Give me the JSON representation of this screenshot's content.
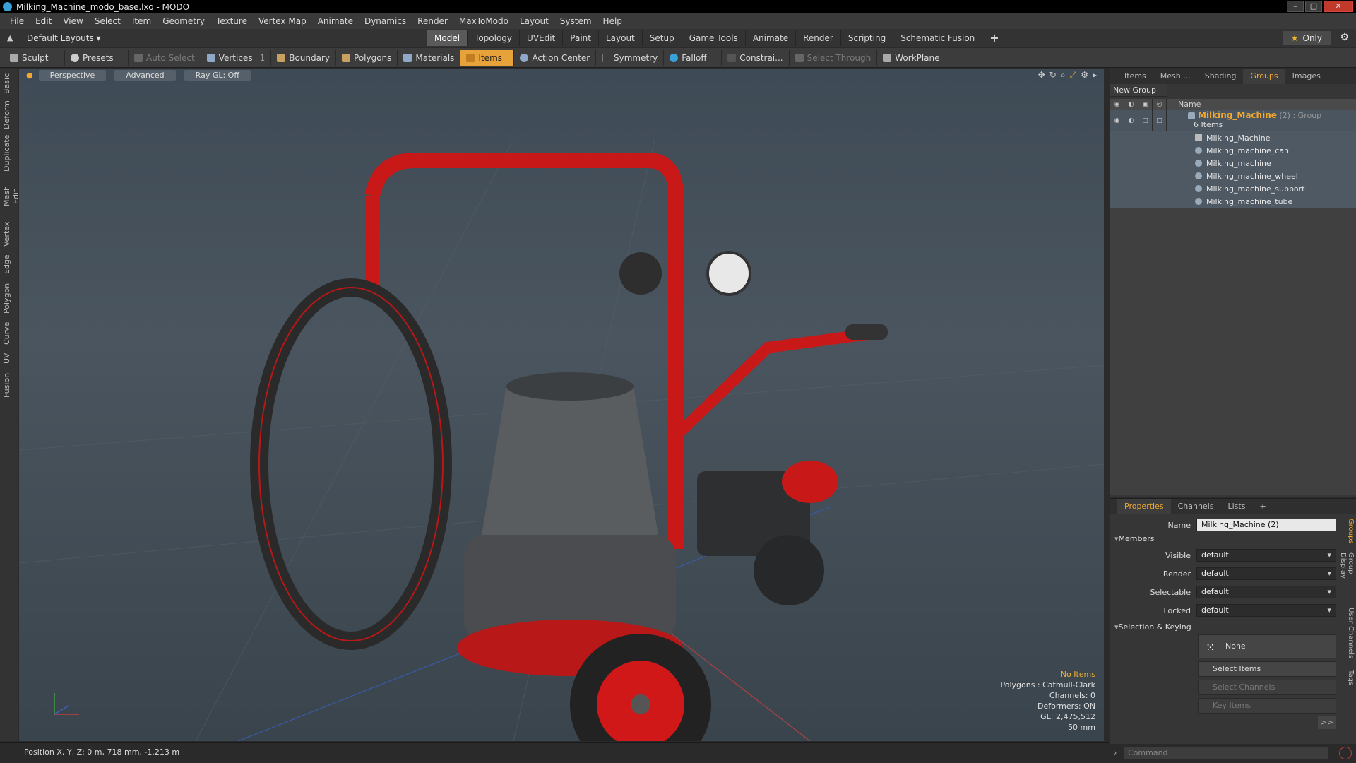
{
  "window": {
    "title": "Milking_Machine_modo_base.lxo - MODO",
    "controls": [
      "–",
      "□",
      "✕"
    ]
  },
  "menu": [
    "File",
    "Edit",
    "View",
    "Select",
    "Item",
    "Geometry",
    "Texture",
    "Vertex Map",
    "Animate",
    "Dynamics",
    "Render",
    "MaxToModo",
    "Layout",
    "System",
    "Help"
  ],
  "layout_selector": "Default Layouts",
  "mode_tabs": [
    "Model",
    "Topology",
    "UVEdit",
    "Paint",
    "Layout",
    "Setup",
    "Game Tools",
    "Animate",
    "Render",
    "Scripting",
    "Schematic Fusion",
    "+"
  ],
  "active_mode_tab": "Model",
  "only_label": "Only",
  "tools": {
    "sculpt": "Sculpt",
    "presets": "Presets",
    "auto_select": "Auto Select",
    "vertices": "Vertices",
    "vertices_count": "1",
    "boundary": "Boundary",
    "polygons": "Polygons",
    "materials": "Materials",
    "items": "Items",
    "action_center": "Action Center",
    "symmetry": "Symmetry",
    "falloff": "Falloff",
    "constraints": "Constrai...",
    "select_through": "Select Through",
    "workplane": "WorkPlane"
  },
  "left_tabs": [
    "Basic",
    "Deform",
    "Duplicate",
    "Mesh Edit",
    "Vertex",
    "Edge",
    "Polygon",
    "Curve",
    "UV",
    "Fusion"
  ],
  "viewport": {
    "view": "Perspective",
    "shading": "Advanced",
    "raygl": "Ray GL: Off"
  },
  "stats": {
    "no_items": "No Items",
    "polygons": "Polygons : Catmull-Clark",
    "channels": "Channels: 0",
    "deformers": "Deformers: ON",
    "gl": "GL: 2,475,512",
    "focal": "50 mm"
  },
  "status": "Position X, Y, Z:  0 m, 718 mm, -1.213 m",
  "panel_tabs": [
    "Items",
    "Mesh ...",
    "Shading",
    "Groups",
    "Images",
    "+"
  ],
  "active_panel_tab": "Groups",
  "new_group": "New Group",
  "column_name": "Name",
  "group": {
    "name": "Milking_Machine",
    "suffix": "(2) : Group",
    "count": "6 Items"
  },
  "group_items": [
    "Milking_Machine",
    "Milking_machine_can",
    "Milking_machine",
    "Milking_machine_wheel",
    "Milking_machine_support",
    "Milking_machine_tube"
  ],
  "props_tabs": [
    "Properties",
    "Channels",
    "Lists",
    "+"
  ],
  "props": {
    "name_label": "Name",
    "name_value": "Milking_Machine (2)",
    "members": "Members",
    "visible_label": "Visible",
    "visible": "default",
    "render_label": "Render",
    "render": "default",
    "selectable_label": "Selectable",
    "selectable": "default",
    "locked_label": "Locked",
    "locked": "default",
    "sel_key": "Selection & Keying",
    "none": "None",
    "select_items": "Select Items",
    "select_channels": "Select Channels",
    "key_items": "Key Items",
    "more": ">>"
  },
  "right_vtabs": [
    "Groups",
    "Group Display",
    "User Channels",
    "Tags"
  ],
  "command_placeholder": "Command"
}
